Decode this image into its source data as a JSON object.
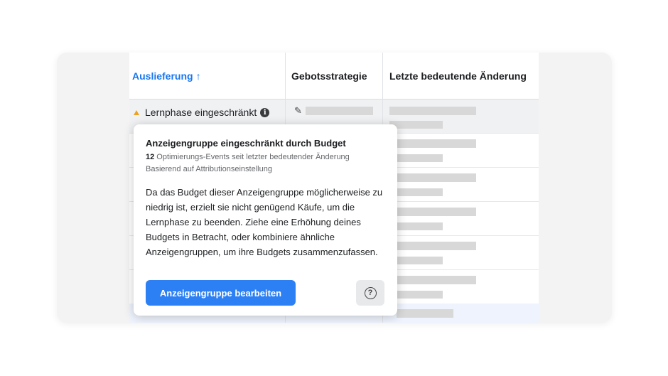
{
  "table": {
    "columns": [
      {
        "label": "Auslieferung",
        "sort_icon": "arrow-up-icon",
        "sort_glyph": "↑"
      },
      {
        "label": "Gebotsstrategie"
      },
      {
        "label": "Letzte bedeutende Änderung"
      }
    ],
    "first_row": {
      "status": "Lernphase eingeschränkt",
      "status_icon": "warning-triangle-icon",
      "info_glyph": "i",
      "edit_glyph": "✎"
    }
  },
  "popup": {
    "title": "Anzeigengruppe eingeschränkt durch Budget",
    "events_count": "12",
    "events_text": " Optimierungs-Events seit letzter bedeutender Änderung",
    "attribution": "Basierend auf Attributionseinstellung",
    "body": "Da das Budget dieser Anzeigengruppe möglicherweise zu niedrig ist, erzielt sie nicht genügend Käufe, um die Lernphase zu beenden. Ziehe eine Erhöhung deines Budgets in Betracht, oder kombiniere ähnliche Anzeigengruppen, um ihre Budgets zusammenzufassen.",
    "primary_button": "Anzeigengruppe bearbeiten",
    "help_glyph": "?"
  },
  "colors": {
    "accent": "#1877f2",
    "button": "#2d80f4",
    "warning": "#f0a21f"
  }
}
